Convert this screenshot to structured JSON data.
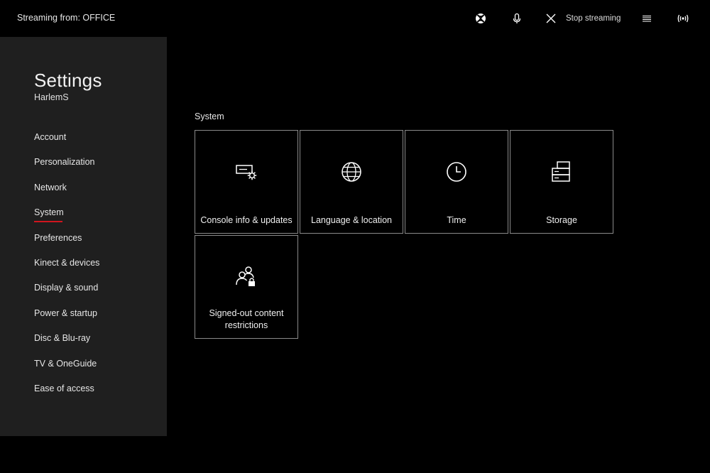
{
  "topbar": {
    "stream_label": "Streaming from: OFFICE",
    "icons": [
      "xbox-icon",
      "microphone-icon",
      "close-icon",
      "menu-icon",
      "broadcast-icon"
    ],
    "stop_label": "Stop streaming"
  },
  "sidebar": {
    "title": "Settings",
    "user": "HarlemS",
    "items": [
      {
        "label": "Account"
      },
      {
        "label": "Personalization"
      },
      {
        "label": "Network"
      },
      {
        "label": "System",
        "active": true
      },
      {
        "label": "Preferences"
      },
      {
        "label": "Kinect & devices"
      },
      {
        "label": "Display & sound"
      },
      {
        "label": "Power & startup"
      },
      {
        "label": "Disc & Blu-ray"
      },
      {
        "label": "TV & OneGuide"
      },
      {
        "label": "Ease of access"
      }
    ]
  },
  "main": {
    "section_title": "System",
    "tiles": [
      {
        "label": "Console info & updates",
        "icon": "console-gear-icon"
      },
      {
        "label": "Language & location",
        "icon": "globe-icon"
      },
      {
        "label": "Time",
        "icon": "clock-icon"
      },
      {
        "label": "Storage",
        "icon": "storage-icon"
      },
      {
        "label": "Signed-out content restrictions",
        "icon": "users-lock-icon"
      }
    ]
  },
  "colors": {
    "background": "#000000",
    "sidebar": "#1f1f1f",
    "accent": "#d0161e",
    "tile_border": "#8a8a8a"
  }
}
